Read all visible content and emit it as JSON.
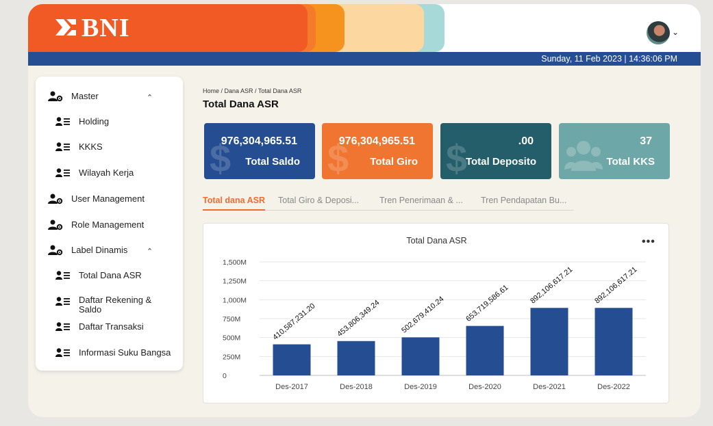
{
  "header": {
    "logo_text": "BNI",
    "date_time": "Sunday, 11 Feb 2023 | 14:36:06 PM",
    "colors": {
      "brand_orange": "#f15a24",
      "brand_blue": "#264f93"
    }
  },
  "sidebar": {
    "items": [
      {
        "label": "Master",
        "icon": "user-gear-icon",
        "expandable": true
      },
      {
        "label": "Holding",
        "icon": "user-list-icon"
      },
      {
        "label": "KKKS",
        "icon": "user-list-icon"
      },
      {
        "label": "Wilayah Kerja",
        "icon": "user-list-icon"
      },
      {
        "label": "User Management",
        "icon": "user-gear-icon"
      },
      {
        "label": "Role Management",
        "icon": "user-gear-icon"
      },
      {
        "label": "Label Dinamis",
        "icon": "user-gear-icon",
        "expandable": true
      },
      {
        "label": "Total Dana ASR",
        "icon": "user-list-icon"
      },
      {
        "label": "Daftar Rekening & Saldo",
        "icon": "user-list-icon"
      },
      {
        "label": "Daftar Transaksi",
        "icon": "user-list-icon"
      },
      {
        "label": "Informasi Suku Bangsa",
        "icon": "user-list-icon"
      }
    ],
    "caret_symbol": "⌃"
  },
  "main": {
    "breadcrumb": "Home / Dana ASR / Total Dana ASR",
    "title": "Total Dana ASR",
    "cards": [
      {
        "value": "976,304,965.51",
        "caption": "Total Saldo",
        "color": "#244e91",
        "icon": "dollar-icon"
      },
      {
        "value": "976,304,965.51",
        "caption": "Total Giro",
        "color": "#ef7530",
        "icon": "dollar-icon"
      },
      {
        "value": ".00",
        "caption": "Total Deposito",
        "color": "#255e6b",
        "icon": "dollar-icon"
      },
      {
        "value": "37",
        "caption": "Total KKS",
        "color": "#6ea7a7",
        "icon": "users-icon"
      }
    ],
    "tabs": [
      {
        "label": "Total dana ASR",
        "active": true
      },
      {
        "label": "Total Giro & Deposi...",
        "active": false
      },
      {
        "label": "Tren Penerimaan & ...",
        "active": false
      },
      {
        "label": "Tren Pendapatan Bu...",
        "active": false
      }
    ]
  },
  "chart_data": {
    "type": "bar",
    "title": "Total Dana ASR",
    "categories": [
      "Des-2017",
      "Des-2018",
      "Des-2019",
      "Des-2020",
      "Des-2021",
      "Des-2022"
    ],
    "values": [
      410587231.2,
      453806349.24,
      502679410.24,
      653719586.61,
      892106617.21,
      892106617.21
    ],
    "data_labels": [
      "410,587,231.20",
      "453,806,349.24",
      "502,679,410.24",
      "653,719,586.61",
      "892,106,617.21",
      "892,106,617.21"
    ],
    "y_ticks": [
      0,
      250000000,
      500000000,
      750000000,
      1000000000,
      1250000000,
      1500000000
    ],
    "y_tick_labels": [
      "0",
      "250M",
      "500M",
      "750M",
      "1,000M",
      "1,250M",
      "1,500M"
    ],
    "ylim": [
      0,
      1500000000
    ],
    "grid": true,
    "bar_color": "#244e91",
    "menu_label": "•••"
  }
}
